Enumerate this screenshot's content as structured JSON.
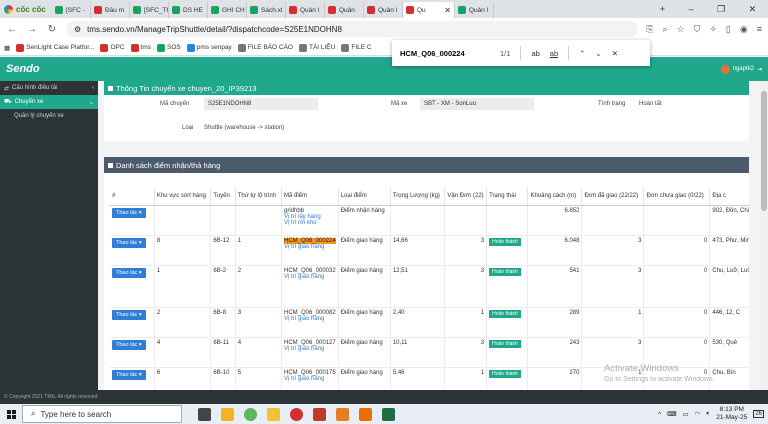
{
  "browser": {
    "brand": "cốc cốc",
    "tabs": [
      {
        "label": "[SFC -",
        "color": "#1aa260"
      },
      {
        "label": "Đầu m",
        "color": "#d32f2f"
      },
      {
        "label": "[SFC_TH",
        "color": "#1aa260"
      },
      {
        "label": "DS HE",
        "color": "#1aa260"
      },
      {
        "label": "GHI CH",
        "color": "#1aa260"
      },
      {
        "label": "Sách.xl",
        "color": "#1aa260"
      },
      {
        "label": "Quản l",
        "color": "#d32f2f"
      },
      {
        "label": "Quản",
        "color": "#d32f2f"
      },
      {
        "label": "Quản l",
        "color": "#d32f2f"
      },
      {
        "label": "Qu",
        "color": "#d32f2f",
        "active": true
      },
      {
        "label": "Quản l",
        "color": "#1aa260"
      }
    ],
    "url": "tms.sendo.vn/ManageTripShuttle/detail/?dispatchcode=S25E1NDOHN8",
    "bookmarks": [
      {
        "label": "SenLight Case Platfor...",
        "color": "#d32f2f"
      },
      {
        "label": "OPC",
        "color": "#d32f2f"
      },
      {
        "label": "tms",
        "color": "#d32f2f"
      },
      {
        "label": "SOS",
        "color": "#1aa260"
      },
      {
        "label": "pms senpay",
        "color": "#1e88e5"
      },
      {
        "label": "FILE BÁO CÁO",
        "color": "#777"
      },
      {
        "label": "TÀI LIỆU",
        "color": "#777"
      },
      {
        "label": "FILE C",
        "color": "#777"
      }
    ]
  },
  "find": {
    "query": "HCM_Q06_000224",
    "count": "1/1",
    "opt_case": "ab",
    "opt_word": "ab",
    "prev": "⌃",
    "next": "⌄",
    "close": "✕"
  },
  "app": {
    "logo": "Sendo",
    "user": "ngaptk2"
  },
  "sidebar": {
    "items": [
      {
        "label": "Cấu hình điều tải"
      },
      {
        "label": "Chuyến xe",
        "active": true
      }
    ],
    "sub": "Quản lý chuyến xe"
  },
  "info": {
    "title": "Thông Tin chuyến xe chuyen_20_IP39213",
    "trip_code_label": "Mã chuyến",
    "trip_code": "S25E1NDOHN8",
    "vehicle_label": "Mã xe",
    "vehicle": "SBT - XM - SonLuu",
    "status_label": "Tình trạng",
    "status": "Hoàn tất",
    "type_label": "Loại",
    "type": "Shuttle (warehouse -> station)"
  },
  "list": {
    "title": "Danh sách điểm nhận/thả hàng",
    "headers": [
      "#",
      "Khu vực sort hàng",
      "Tuyến",
      "Thứ tự lộ trình",
      "Mã điểm",
      "Loại điểm",
      "Trọng Lượng (kg)",
      "Vận Đơn (22)",
      "Trạng thái",
      "Khoảng cách (m)",
      "Đơn đã giao (22/22)",
      "Đơn chưa giao (0/22)",
      "Địa c"
    ],
    "action_label": "Thao tác ▾",
    "rows": [
      {
        "zone": "",
        "route": "",
        "order": "",
        "code": "gridhbb",
        "links": [
          "Vị trí lấy hàng",
          "Vị trí rời kho"
        ],
        "type": "Điểm nhận hàng",
        "weight": "",
        "waybill": "",
        "status": "",
        "distance": "6.852",
        "delivered": "",
        "pending": "",
        "addr": "902, Đồn, Chi"
      },
      {
        "zone": "8",
        "route": "6B-12",
        "order": "1",
        "code": "HCM_Q06_000224",
        "highlight": true,
        "links": [
          "Vị trí giao hàng"
        ],
        "type": "Điểm giao hàng",
        "weight": "14,66",
        "waybill": "3",
        "status": "Hoàn thành",
        "distance": "6.048",
        "delivered": "3",
        "pending": "0",
        "addr": "473, Phư, Minh"
      },
      {
        "zone": "1",
        "route": "6B-2",
        "order": "2",
        "code": "HCM_Q06_000032",
        "links": [
          "Vị trí giao hàng"
        ],
        "type": "Điểm giao hàng",
        "weight": "12,51",
        "waybill": "3",
        "status": "Hoàn thành",
        "distance": "541",
        "delivered": "3",
        "pending": "0",
        "addr": "Chu, Luỡ, Luỡ, 6, Hi"
      },
      {
        "zone": "2",
        "route": "6B-8",
        "order": "3",
        "code": "HCM_Q06_000082",
        "links": [
          "Vị trí giao hàng"
        ],
        "type": "Điểm giao hàng",
        "weight": "2,40",
        "waybill": "1",
        "status": "Hoàn thành",
        "distance": "289",
        "delivered": "1",
        "pending": "0",
        "addr": "446, 12, C"
      },
      {
        "zone": "4",
        "route": "6B-11",
        "order": "4",
        "code": "HCM_Q06_000127",
        "links": [
          "Vị trí giao hàng"
        ],
        "type": "Điểm giao hàng",
        "weight": "10,11",
        "waybill": "3",
        "status": "Hoàn thành",
        "distance": "243",
        "delivered": "3",
        "pending": "0",
        "addr": "530, Quê"
      },
      {
        "zone": "6",
        "route": "6B-10",
        "order": "5",
        "code": "HCM_Q06_000175",
        "links": [
          "Vị trí giao hàng"
        ],
        "type": "Điểm giao hàng",
        "weight": "5,46",
        "waybill": "1",
        "status": "Hoàn thành",
        "distance": "270",
        "delivered": "1",
        "pending": "0",
        "addr": "Chu, Bìn"
      }
    ]
  },
  "footer": "© Copyright 2021 TMS. All rights reserved.",
  "watermark": {
    "line1": "Activate Windows",
    "line2": "Go to Settings to activate Windows."
  },
  "taskbar": {
    "search_placeholder": "Type here to search",
    "time": "8:13 PM",
    "date": "21-May-25",
    "notif_count": "26"
  }
}
